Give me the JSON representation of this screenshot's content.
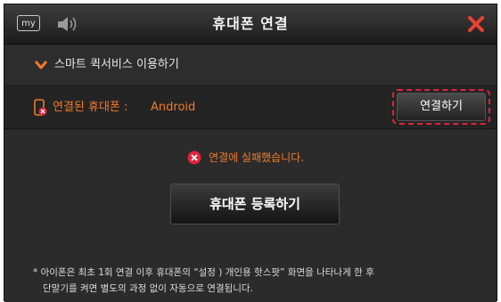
{
  "titlebar": {
    "badge": "my",
    "title": "휴대폰 연결",
    "icons": {
      "speaker": "speaker-icon",
      "close": "close-icon"
    },
    "close_color": "#e8432e"
  },
  "service_row": {
    "icon": "chevron-down-icon",
    "label": "스마트 퀵서비스 이용하기"
  },
  "phone_row": {
    "icon": "phone-disconnected-icon",
    "label": "연결된 휴대폰 :",
    "value": "Android",
    "connect_button": "연결하기",
    "highlight_color": "#e0243a"
  },
  "status": {
    "icon": "error-icon",
    "message": "연결에 실패했습니다."
  },
  "register_button": "휴대폰 등록하기",
  "note": {
    "line1": "* 아이폰은 최초 1회 연결 이후 휴대폰의 “설정 ) 개인용 핫스팟” 화면을 나타나게 한 후",
    "line2": "단말기를 켜면 별도의 과정 없이 자동으로 연결됩니다."
  },
  "colors": {
    "accent": "#f07a2c",
    "background": "#2b2b2b"
  }
}
